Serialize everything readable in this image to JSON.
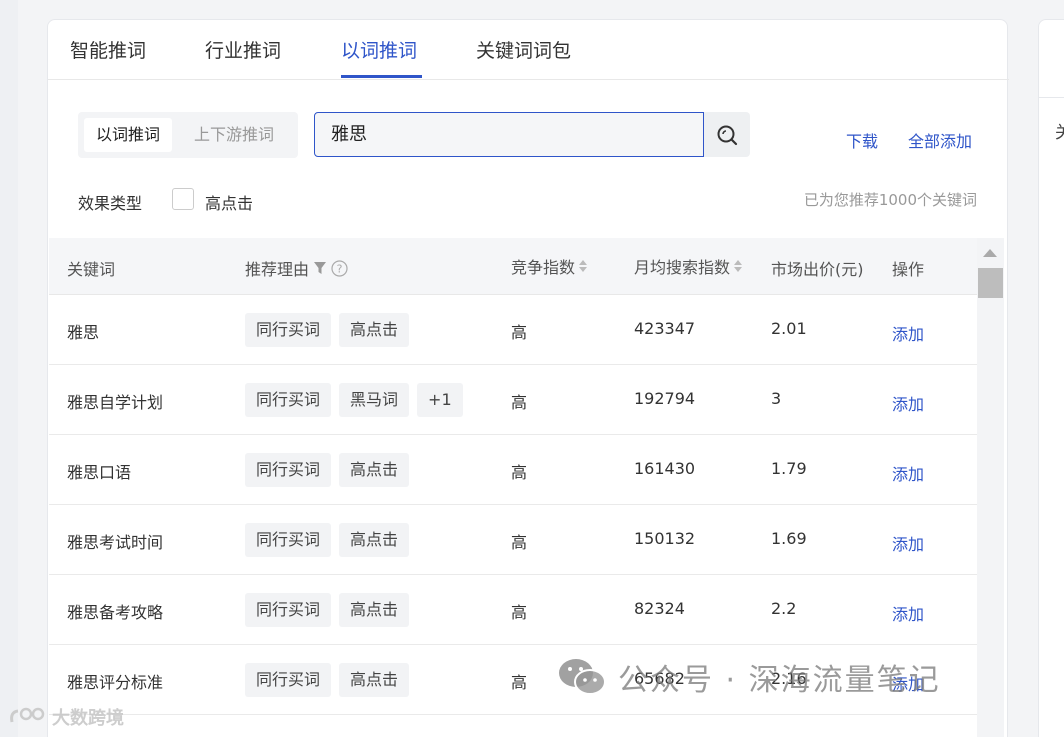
{
  "tabs": [
    "智能推词",
    "行业推词",
    "以词推词",
    "关键词词包"
  ],
  "active_tab_index": 2,
  "segment": {
    "active": "以词推词",
    "inactive": "上下游推词"
  },
  "search": {
    "value": "雅思"
  },
  "actions": {
    "download": "下载",
    "add_all": "全部添加"
  },
  "filter": {
    "label": "效果类型",
    "checkbox_label": "高点击",
    "checked": false
  },
  "recommend_count_text": "已为您推荐1000个关键词",
  "table": {
    "headers": {
      "keyword": "关键词",
      "reason": "推荐理由",
      "competition": "竞争指数",
      "monthly_search": "月均搜索指数",
      "market_bid": "市场出价(元)",
      "operation": "操作"
    },
    "rows": [
      {
        "keyword": "雅思",
        "tags": [
          "同行买词",
          "高点击"
        ],
        "competition": "高",
        "monthly_search": "423347",
        "market_bid": "2.01",
        "action": "添加"
      },
      {
        "keyword": "雅思自学计划",
        "tags": [
          "同行买词",
          "黑马词",
          "+1"
        ],
        "competition": "高",
        "monthly_search": "192794",
        "market_bid": "3",
        "action": "添加"
      },
      {
        "keyword": "雅思口语",
        "tags": [
          "同行买词",
          "高点击"
        ],
        "competition": "高",
        "monthly_search": "161430",
        "market_bid": "1.79",
        "action": "添加"
      },
      {
        "keyword": "雅思考试时间",
        "tags": [
          "同行买词",
          "高点击"
        ],
        "competition": "高",
        "monthly_search": "150132",
        "market_bid": "1.69",
        "action": "添加"
      },
      {
        "keyword": "雅思备考攻略",
        "tags": [
          "同行买词",
          "高点击"
        ],
        "competition": "高",
        "monthly_search": "82324",
        "market_bid": "2.2",
        "action": "添加"
      },
      {
        "keyword": "雅思评分标准",
        "tags": [
          "同行买词",
          "高点击"
        ],
        "competition": "高",
        "monthly_search": "65682",
        "market_bid": "2.16",
        "action": "添加"
      }
    ]
  },
  "right_panel_text": "关",
  "watermark": "公众号 · 深海流量笔记",
  "bottom_logo": "大数跨境",
  "colors": {
    "accent": "#2f55c9",
    "tag_bg": "#f2f3f5",
    "header_bg": "#f5f6f8"
  }
}
